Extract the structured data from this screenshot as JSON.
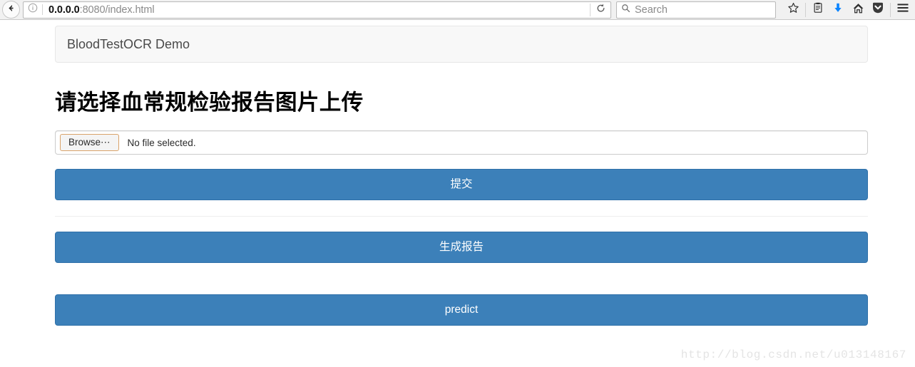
{
  "browser": {
    "back_label": "Back",
    "back_icon": "arrow-left-icon",
    "info_icon": "info-circle-icon",
    "url_host": "0.0.0.0",
    "url_path": ":8080/index.html",
    "url_full": "0.0.0.0:8080/index.html",
    "reload_icon": "reload-icon",
    "search_icon": "search-icon",
    "search_placeholder": "Search",
    "search_value": "",
    "toolbar_icons": [
      {
        "name": "bookmark-star-icon",
        "label": "Bookmark this page"
      },
      {
        "name": "reader-view-icon",
        "label": "Reader view"
      },
      {
        "name": "downloads-icon",
        "label": "Downloads"
      },
      {
        "name": "home-icon",
        "label": "Home"
      },
      {
        "name": "pocket-icon",
        "label": "Save to Pocket"
      },
      {
        "name": "hamburger-menu-icon",
        "label": "Open menu"
      }
    ]
  },
  "page": {
    "navbar_brand": "BloodTestOCR Demo",
    "heading": "请选择血常规检验报告图片上传",
    "file_input": {
      "browse_label": "Browse⋯",
      "file_status": "No file selected."
    },
    "buttons": [
      {
        "name": "submit-button",
        "label": "提交"
      },
      {
        "name": "generate-report-button",
        "label": "生成报告"
      },
      {
        "name": "predict-button",
        "label": "predict"
      }
    ],
    "watermark": "http://blog.csdn.net/u013148167"
  },
  "colors": {
    "primary_button": "#3c80b9",
    "primary_button_border": "#3071a9",
    "panel_bg": "#f8f8f8",
    "panel_border": "#e7e7e7",
    "toolbar_bg": "#f1f1f1",
    "download_icon": "#0a84ff",
    "browse_focus_border": "#d9a36a",
    "watermark_text": "#e4e4e4"
  }
}
